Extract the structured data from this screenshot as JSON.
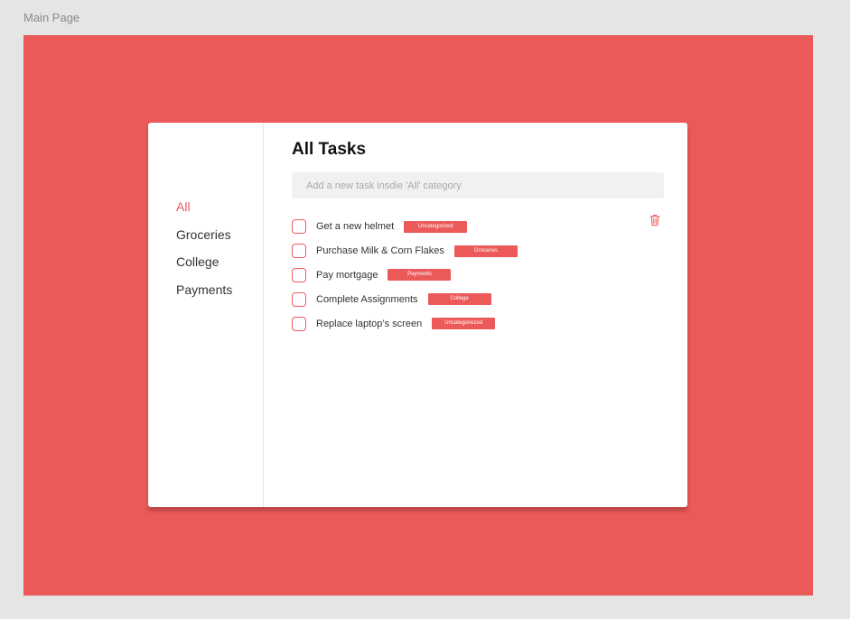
{
  "frame_label": "Main Page",
  "sidebar": {
    "items": [
      {
        "label": "All",
        "active": true
      },
      {
        "label": "Groceries",
        "active": false
      },
      {
        "label": "College",
        "active": false
      },
      {
        "label": "Payments",
        "active": false
      }
    ]
  },
  "main": {
    "title": "All Tasks",
    "input_placeholder": "Add a new task insdie 'All' category",
    "tasks": [
      {
        "text": "Get a new helmet",
        "tag": "Uncategorized"
      },
      {
        "text": "Purchase Milk & Corn Flakes",
        "tag": "Groceries"
      },
      {
        "text": "Pay mortgage",
        "tag": "Payments"
      },
      {
        "text": "Complete Assignments",
        "tag": "College"
      },
      {
        "text": "Replace laptop’s screen",
        "tag": "Uncategoriezed"
      }
    ]
  },
  "icons": {
    "delete": "trash-icon"
  },
  "colors": {
    "accent": "#eb5a58",
    "card": "#ffffff",
    "page_background": "#e5e5e5",
    "input_background": "#f1f1f1"
  }
}
